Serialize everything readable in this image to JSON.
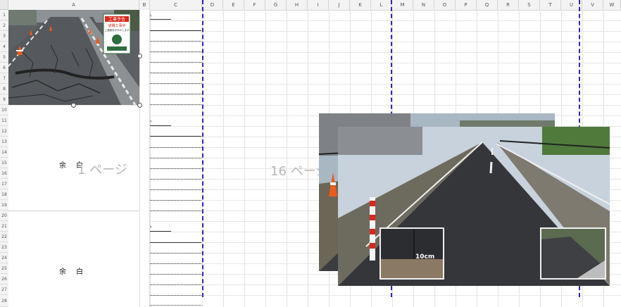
{
  "columns": [
    "A",
    "B",
    "C",
    "D",
    "E",
    "F",
    "G",
    "H",
    "I",
    "J",
    "K",
    "L",
    "M",
    "N",
    "O",
    "P",
    "Q",
    "R",
    "S",
    "T",
    "U",
    "V",
    "W"
  ],
  "rows": [
    "1",
    "2",
    "3",
    "4",
    "5",
    "6",
    "7",
    "8",
    "9",
    "10",
    "11",
    "12",
    "13",
    "14",
    "15",
    "16",
    "17",
    "18",
    "19",
    "20",
    "21",
    "22",
    "23",
    "24",
    "25",
    "26",
    "27",
    "28"
  ],
  "blocks": [
    {
      "label": "余　白"
    },
    {
      "label": "余　白"
    }
  ],
  "watermarks": {
    "page1": "1 ページ",
    "page16": "16 ページ"
  },
  "photo1": {
    "sign_title": "工事予告",
    "sign_line1": "道路工事中",
    "sign_line2": "ご迷惑をおかけします"
  },
  "photo3": {
    "inset_label": "10cm"
  },
  "colors": {
    "page_break": "#2a2aa8",
    "cone": "#ef5a1a",
    "asphalt": "#3a3c40",
    "roller": "#e6b21e"
  }
}
